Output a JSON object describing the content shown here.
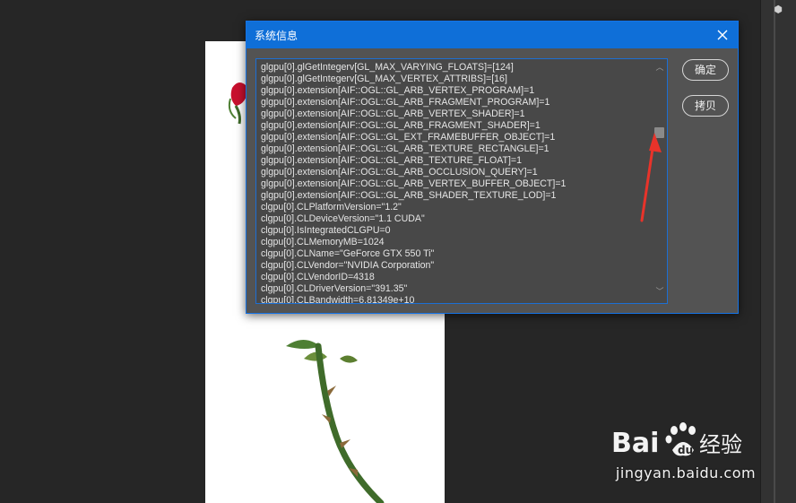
{
  "dialog": {
    "title": "系统信息",
    "close_icon": "close-icon",
    "lines": [
      "glgpu[0].glGetIntegerv[GL_MAX_VARYING_FLOATS]=[124]",
      "glgpu[0].glGetIntegerv[GL_MAX_VERTEX_ATTRIBS]=[16]",
      "glgpu[0].extension[AIF::OGL::GL_ARB_VERTEX_PROGRAM]=1",
      "glgpu[0].extension[AIF::OGL::GL_ARB_FRAGMENT_PROGRAM]=1",
      "glgpu[0].extension[AIF::OGL::GL_ARB_VERTEX_SHADER]=1",
      "glgpu[0].extension[AIF::OGL::GL_ARB_FRAGMENT_SHADER]=1",
      "glgpu[0].extension[AIF::OGL::GL_EXT_FRAMEBUFFER_OBJECT]=1",
      "glgpu[0].extension[AIF::OGL::GL_ARB_TEXTURE_RECTANGLE]=1",
      "glgpu[0].extension[AIF::OGL::GL_ARB_TEXTURE_FLOAT]=1",
      "glgpu[0].extension[AIF::OGL::GL_ARB_OCCLUSION_QUERY]=1",
      "glgpu[0].extension[AIF::OGL::GL_ARB_VERTEX_BUFFER_OBJECT]=1",
      "glgpu[0].extension[AIF::OGL::GL_ARB_SHADER_TEXTURE_LOD]=1",
      "clgpu[0].CLPlatformVersion=\"1.2\"",
      "clgpu[0].CLDeviceVersion=\"1.1 CUDA\"",
      "clgpu[0].IsIntegratedCLGPU=0",
      "clgpu[0].CLMemoryMB=1024",
      "clgpu[0].CLName=\"GeForce GTX 550 Ti\"",
      "clgpu[0].CLVendor=\"NVIDIA Corporation\"",
      "clgpu[0].CLVendorID=4318",
      "clgpu[0].CLDriverVersion=\"391.35\"",
      "clgpu[0].CLBandwidth=6.81349e+10"
    ],
    "buttons": {
      "ok": "确定",
      "copy": "拷贝"
    },
    "scroll_position": 0.25
  },
  "watermark": {
    "logo_text": "Bai du 经验",
    "url": "jingyan.baidu.com"
  },
  "colors": {
    "title_bar": "#0f6fd8",
    "dialog_bg": "#535353",
    "workspace_bg": "#262626",
    "arrow": "#e8332a",
    "rose_red": "#c8102e",
    "stem_green": "#3f6b2a"
  }
}
